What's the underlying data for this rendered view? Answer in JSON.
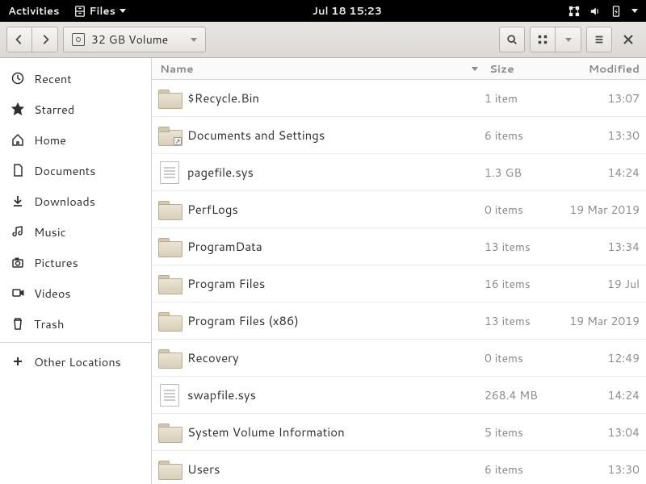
{
  "topbar": {
    "activities": "Activities",
    "files": "Files",
    "datetime": "Jul 18  15:23"
  },
  "toolbar": {
    "location": "32 GB Volume"
  },
  "sidebar": {
    "items": [
      {
        "label": "Recent",
        "icon": "clock"
      },
      {
        "label": "Starred",
        "icon": "star"
      },
      {
        "label": "Home",
        "icon": "home"
      },
      {
        "label": "Documents",
        "icon": "doc"
      },
      {
        "label": "Downloads",
        "icon": "download"
      },
      {
        "label": "Music",
        "icon": "music"
      },
      {
        "label": "Pictures",
        "icon": "camera"
      },
      {
        "label": "Videos",
        "icon": "video"
      },
      {
        "label": "Trash",
        "icon": "trash"
      }
    ],
    "other": "Other Locations"
  },
  "columns": {
    "name": "Name",
    "size": "Size",
    "modified": "Modified"
  },
  "rows": [
    {
      "name": "$Recycle.Bin",
      "type": "folder",
      "size": "1 item",
      "mod": "13:07"
    },
    {
      "name": "Documents and Settings",
      "type": "folderlink",
      "size": "6 items",
      "mod": "13:30"
    },
    {
      "name": "pagefile.sys",
      "type": "file",
      "size": "1.3 GB",
      "mod": "14:24"
    },
    {
      "name": "PerfLogs",
      "type": "folder",
      "size": "0 items",
      "mod": "19 Mar 2019"
    },
    {
      "name": "ProgramData",
      "type": "folder",
      "size": "13 items",
      "mod": "13:34"
    },
    {
      "name": "Program Files",
      "type": "folder",
      "size": "16 items",
      "mod": "19 Jul"
    },
    {
      "name": "Program Files (x86)",
      "type": "folder",
      "size": "13 items",
      "mod": "19 Mar 2019"
    },
    {
      "name": "Recovery",
      "type": "folder",
      "size": "0 items",
      "mod": "12:49"
    },
    {
      "name": "swapfile.sys",
      "type": "file",
      "size": "268.4 MB",
      "mod": "14:24"
    },
    {
      "name": "System Volume Information",
      "type": "folder",
      "size": "5 items",
      "mod": "13:04"
    },
    {
      "name": "Users",
      "type": "folder",
      "size": "6 items",
      "mod": "13:30"
    }
  ]
}
